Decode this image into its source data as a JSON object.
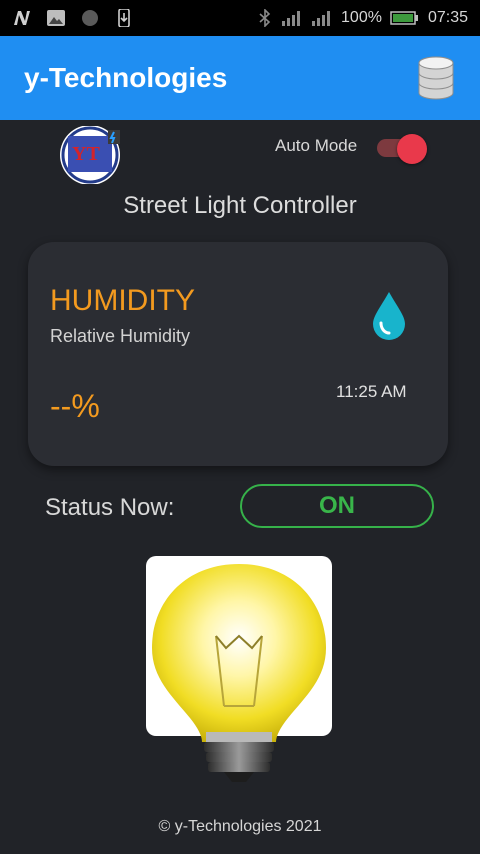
{
  "status_bar": {
    "battery": "100%",
    "time": "07:35"
  },
  "app_bar": {
    "title": "y-Technologies",
    "database_icon": "database-icon"
  },
  "header": {
    "logo_text": "YT",
    "auto_mode_label": "Auto Mode",
    "auto_mode_on": true,
    "subtitle": "Street Light Controller"
  },
  "sensor_card": {
    "title": "HUMIDITY",
    "subtitle": "Relative Humidity",
    "value": "--%",
    "time": "11:25 AM",
    "icon": "water-drop-icon"
  },
  "status": {
    "label": "Status Now:",
    "value": "ON"
  },
  "footer": {
    "text": "© y-Technologies 2021"
  },
  "colors": {
    "accent_blue": "#1f8ef2",
    "accent_orange": "#f39a1f",
    "status_green": "#39b54a",
    "toggle_red": "#e9394b",
    "drop_cyan": "#18b4cc"
  }
}
